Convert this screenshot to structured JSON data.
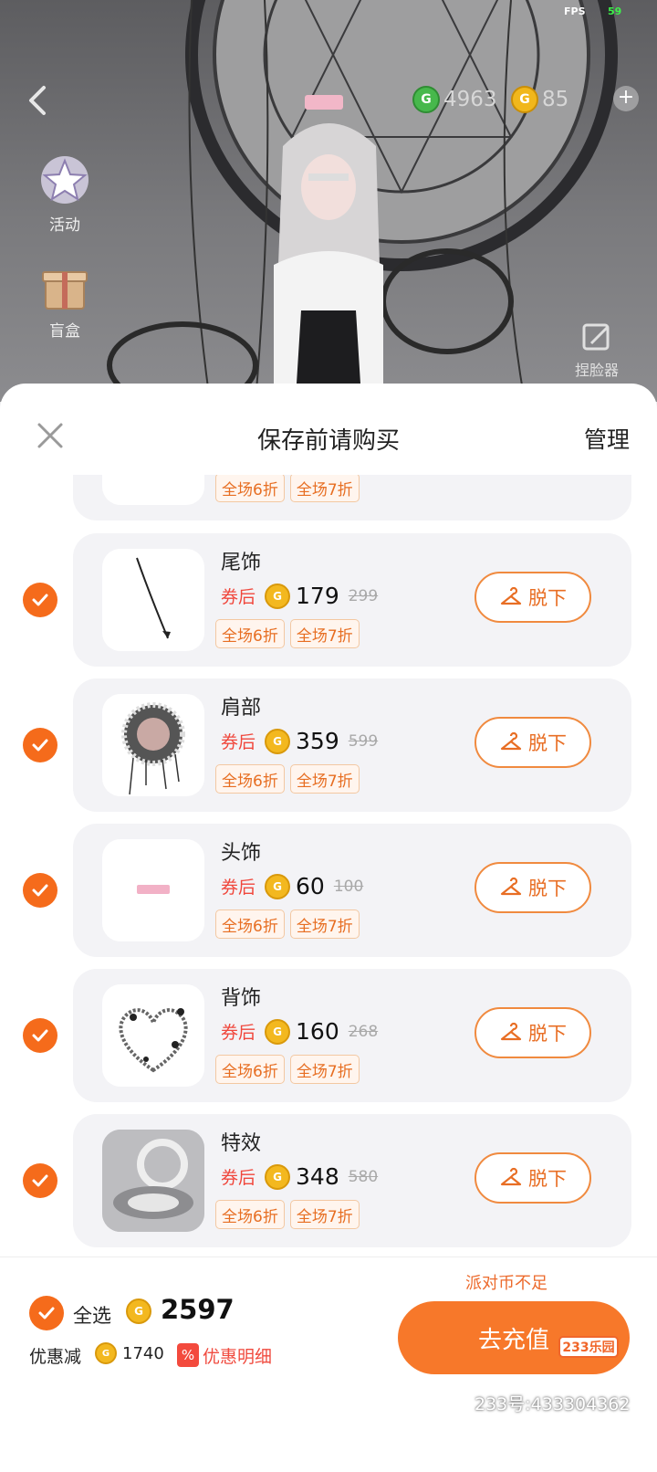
{
  "status": {
    "fps_label": "FPS",
    "fps_value": "59"
  },
  "top_bar": {
    "currency_g": "4963",
    "currency_gold": "85",
    "coin_g_symbol": "G",
    "plus": "+"
  },
  "side_menu": [
    {
      "label": "活动",
      "icon": "star-icon"
    },
    {
      "label": "盲盒",
      "icon": "gift-box-icon"
    }
  ],
  "right_tool": {
    "label": "捏脸器",
    "icon": "edit-icon"
  },
  "sheet": {
    "title": "保存前请购买",
    "manage": "管理"
  },
  "coupon_label": "券后",
  "tag_1": "全场6折",
  "tag_2": "全场7折",
  "takeoff_label": "脱下",
  "items": [
    {
      "name": "尾饰",
      "price": "179",
      "original_price": "299",
      "selected": true,
      "thumb": "tail-thumbnail"
    },
    {
      "name": "肩部",
      "price": "359",
      "original_price": "599",
      "selected": true,
      "thumb": "shoulder-thumbnail"
    },
    {
      "name": "头饰",
      "price": "60",
      "original_price": "100",
      "selected": true,
      "thumb": "headwear-thumbnail"
    },
    {
      "name": "背饰",
      "price": "160",
      "original_price": "268",
      "selected": true,
      "thumb": "back-accessory-thumbnail"
    },
    {
      "name": "特效",
      "price": "348",
      "original_price": "580",
      "selected": true,
      "thumb": "effect-thumbnail"
    }
  ],
  "footer": {
    "insufficient": "派对币不足",
    "select_all": "全选",
    "total": "2597",
    "discount_label": "优惠减",
    "discount_value": "1740",
    "percent_badge": "%",
    "discount_detail": "优惠明细",
    "recharge": "去充值"
  },
  "watermark": {
    "logo": "233乐园",
    "id": "233号:433304362"
  },
  "colors": {
    "accent": "#f56b1b",
    "price_red": "#f0473c",
    "coin_gold": "#f3b81f",
    "card_bg": "#f3f3f6"
  }
}
